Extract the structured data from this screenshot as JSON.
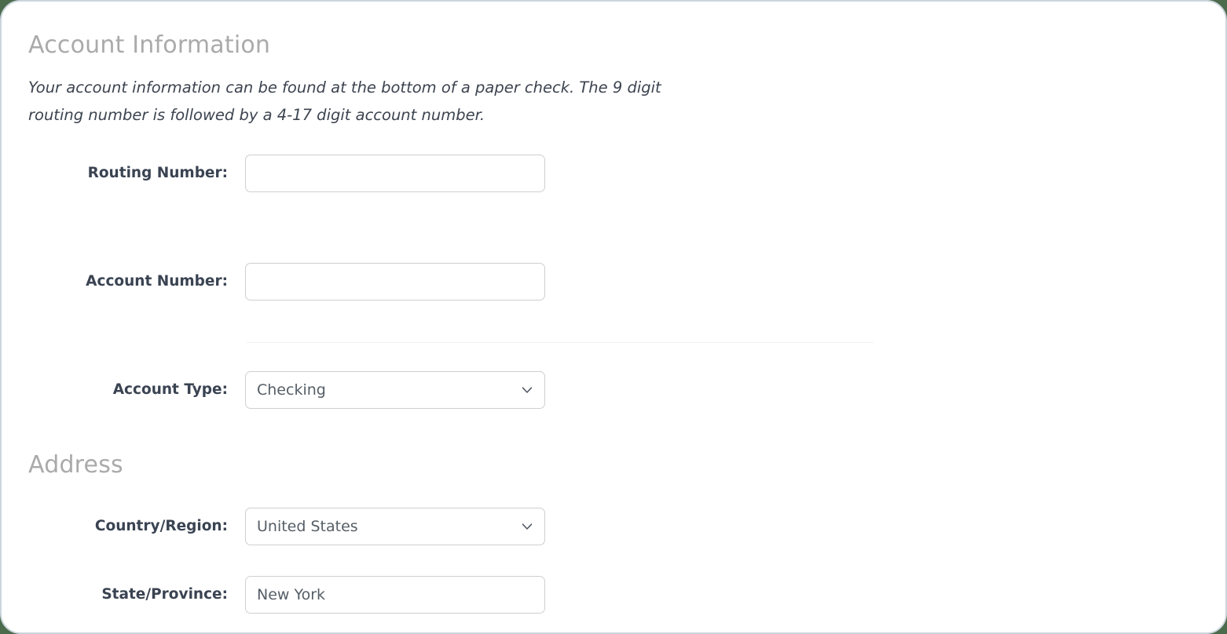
{
  "page": {
    "background_color": "#4b6b4c",
    "card_background": "#ffffff",
    "card_border_color": "#ccd5dc",
    "heading_color": "#aaaaaa",
    "label_color": "#3a4352",
    "value_color": "#555e66",
    "input_border_color": "#cfcfcf",
    "divider_color": "#f0f1f3"
  },
  "account_information": {
    "heading": "Account Information",
    "helper_text": "Your account information can be found at the bottom of a paper check. The 9 digit routing number is followed by a 4-17 digit account number.",
    "helper_text_line1": "Your account information can be found at the bottom of a paper check. The 9 digit",
    "helper_text_line2": "routing number is followed by a 4-17 digit account number.",
    "fields": [
      {
        "label": "Routing Number:",
        "type": "text",
        "value": "",
        "placeholder": ""
      },
      {
        "label": "Account Number:",
        "type": "text",
        "value": "",
        "placeholder": ""
      },
      {
        "label": "Account Type:",
        "type": "select",
        "value": "Checking",
        "icon": "chevron-down-icon"
      }
    ]
  },
  "address": {
    "heading": "Address",
    "fields": [
      {
        "label": "Country/Region:",
        "type": "select",
        "value": "United States",
        "icon": "chevron-down-icon"
      },
      {
        "label": "State/Province:",
        "type": "text",
        "value": "New York",
        "placeholder": ""
      }
    ]
  }
}
